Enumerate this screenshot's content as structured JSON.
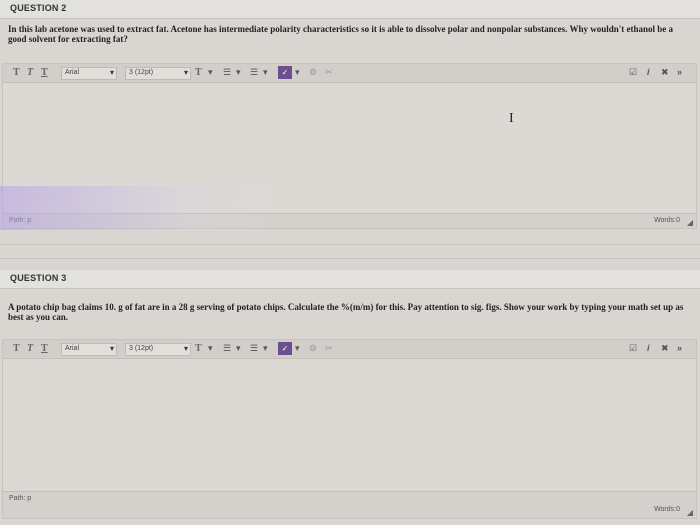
{
  "questions": [
    {
      "title": "QUESTION 2",
      "text": "In this lab acetone was used to extract fat. Acetone has intermediate polarity characteristics so it is able to dissolve polar and nonpolar substances. Why wouldn't ethanol be a good solvent for extracting fat?",
      "toolbar": {
        "t1": "T",
        "t2": "T",
        "t3": "T",
        "font": "Arial",
        "size": "3 (12pt)",
        "tcolor": "T",
        "list_ordered": "☰",
        "list_bullets": "☰",
        "caret": "▾",
        "purple": "✓"
      },
      "status": {
        "path": "Path: p",
        "words": "Words:0"
      }
    },
    {
      "title": "QUESTION 3",
      "text": "A potato chip bag claims 10. g of fat are in a 28 g serving of potato chips. Calculate the %(m/m) for this. Pay attention to sig. figs. Show your work by typing your math set up as best as you can.",
      "toolbar": {
        "t1": "T",
        "t2": "T",
        "t3": "T",
        "font": "Arial",
        "size": "3 (12pt)",
        "tcolor": "T",
        "list_ordered": "☰",
        "list_bullets": "☰",
        "caret": "▾",
        "purple": "✓"
      },
      "status": {
        "path": "Path: p",
        "words": "Words:0"
      }
    }
  ],
  "icons": {
    "spell": "☑",
    "info": "i",
    "fullscreen": "✖",
    "collapse": "»",
    "link": "⚙",
    "unlink": "✂"
  },
  "cursor": "I"
}
